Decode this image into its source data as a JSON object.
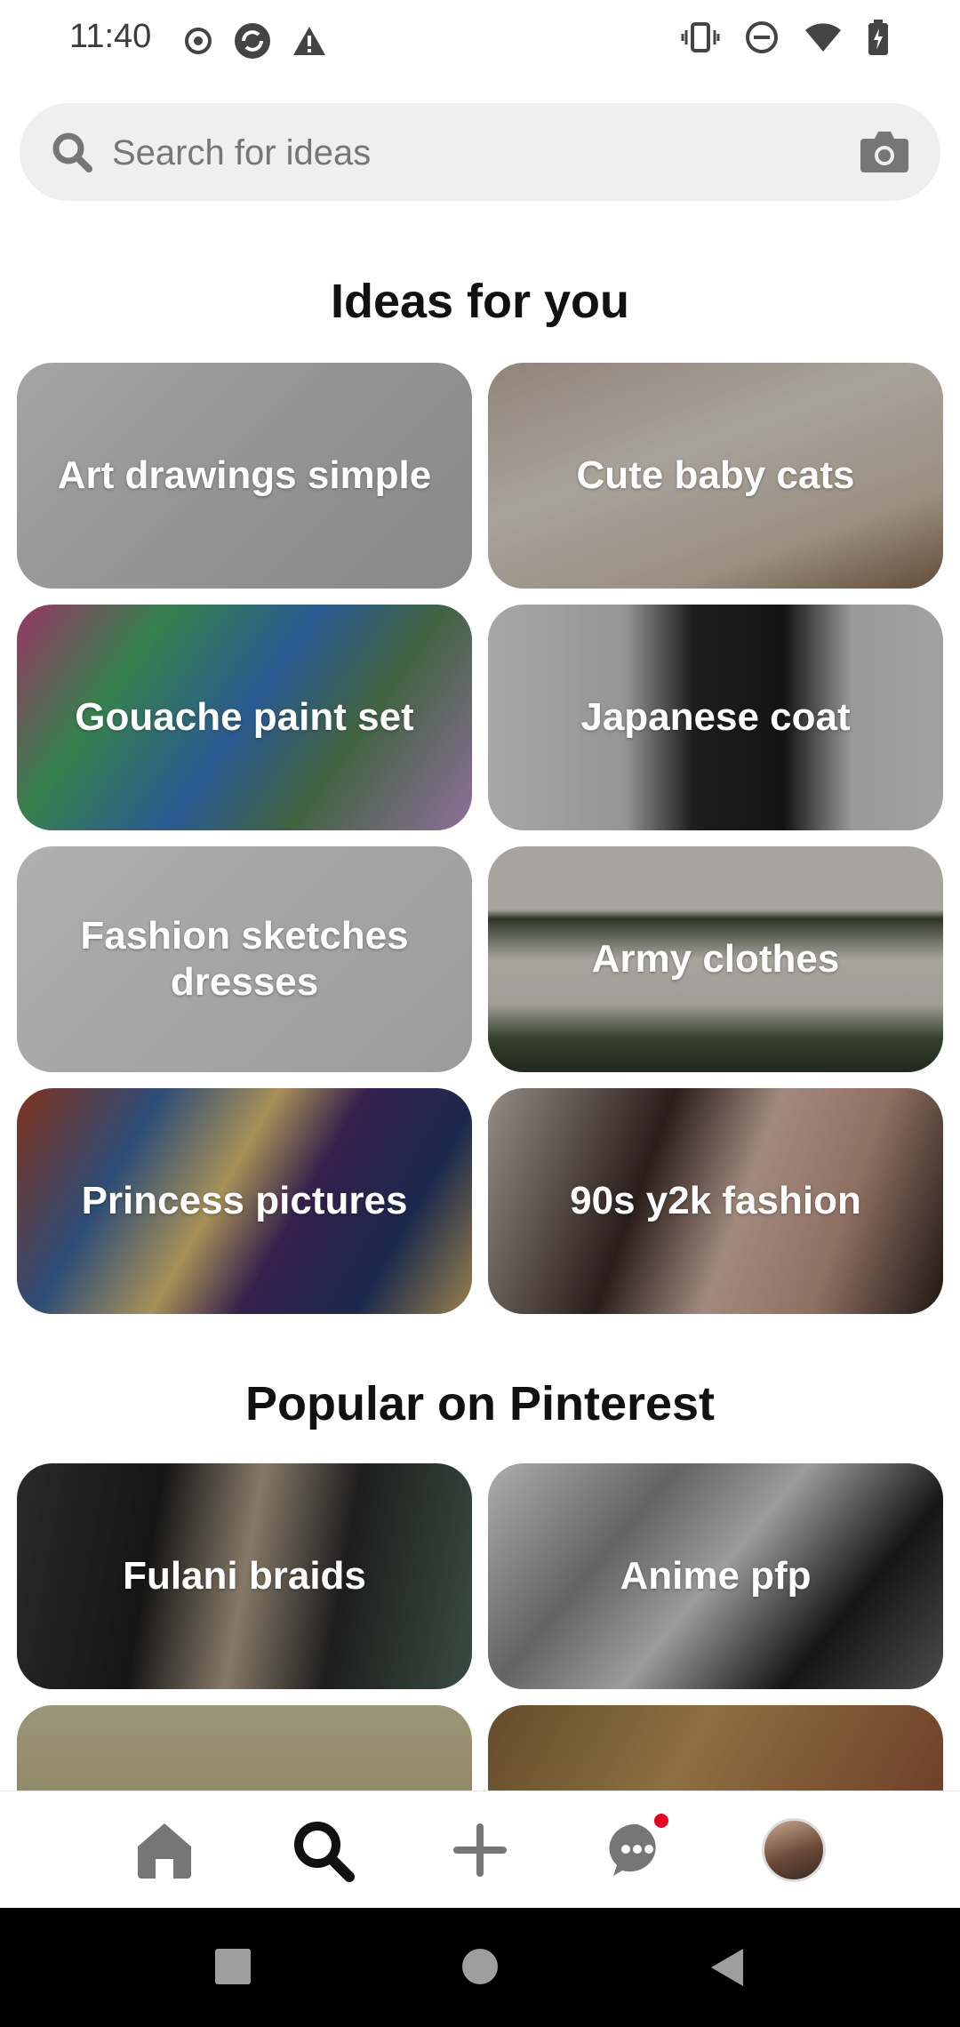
{
  "status_bar": {
    "time": "11:40",
    "left_icons": [
      "record-icon",
      "sync-icon",
      "warning-icon"
    ],
    "right_icons": [
      "vibrate-icon",
      "do-not-disturb-icon",
      "wifi-icon",
      "battery-charging-icon"
    ]
  },
  "search": {
    "placeholder": "Search for ideas",
    "left_icon": "search-icon",
    "right_icon": "camera-icon"
  },
  "ideas_section": {
    "title": "Ideas for you",
    "tiles": [
      {
        "label": "Art drawings simple"
      },
      {
        "label": "Cute baby cats"
      },
      {
        "label": "Gouache paint set"
      },
      {
        "label": "Japanese coat"
      },
      {
        "label": "Fashion sketches dresses"
      },
      {
        "label": "Army clothes"
      },
      {
        "label": "Princess pictures"
      },
      {
        "label": "90s y2k fashion"
      }
    ]
  },
  "popular_section": {
    "title": "Popular on Pinterest",
    "tiles": [
      {
        "label": "Fulani braids"
      },
      {
        "label": "Anime pfp"
      },
      {
        "label": ""
      },
      {
        "label": ""
      }
    ]
  },
  "bottom_nav": {
    "items": [
      "home-icon",
      "search-icon",
      "create-icon",
      "messages-icon",
      "profile-avatar"
    ],
    "active": "search-icon",
    "notification_color": "#e60023"
  },
  "system_nav": [
    "recents-button",
    "home-button",
    "back-button"
  ]
}
